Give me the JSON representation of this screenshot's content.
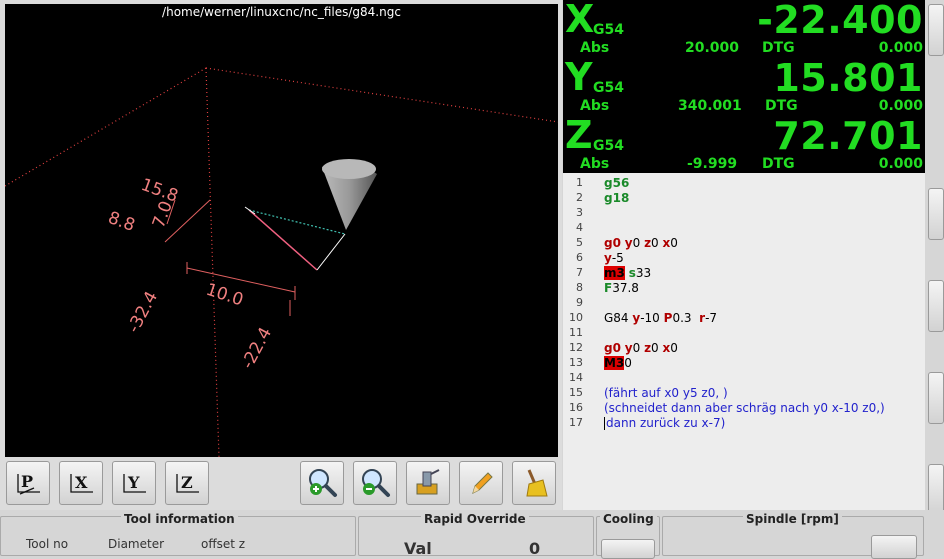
{
  "viewport": {
    "file_path": "/home/werner/linuxcnc/nc_files/g84.ngc",
    "dimension_labels": [
      "15.8",
      "8.8",
      "7.0",
      "10.0",
      "-32.4",
      "-22.4"
    ]
  },
  "toolbar": {
    "buttons": [
      {
        "name": "view-p-button",
        "label": "P"
      },
      {
        "name": "view-x-button",
        "label": "X"
      },
      {
        "name": "view-y-button",
        "label": "Y"
      },
      {
        "name": "view-z-button",
        "label": "Z"
      }
    ],
    "icon_buttons": [
      "zoom-in-icon",
      "zoom-out-icon",
      "rotate-view-icon",
      "pencil-icon",
      "broom-icon"
    ]
  },
  "dro": {
    "color": "#22dd22",
    "axes": [
      {
        "letter": "X",
        "coord": "G54",
        "value": "-22.400",
        "abs_label": "Abs",
        "abs": "20.000",
        "dtg_label": "DTG",
        "dtg": "0.000"
      },
      {
        "letter": "Y",
        "coord": "G54",
        "value": "15.801",
        "abs_label": "Abs",
        "abs": "340.001",
        "dtg_label": "DTG",
        "dtg": "0.000"
      },
      {
        "letter": "Z",
        "coord": "G54",
        "value": "72.701",
        "abs_label": "Abs",
        "abs": "-9.999",
        "dtg_label": "DTG",
        "dtg": "0.000"
      }
    ]
  },
  "editor": {
    "lines": [
      {
        "n": "1",
        "tokens": [
          {
            "t": "g56",
            "c": "g"
          }
        ]
      },
      {
        "n": "2",
        "tokens": [
          {
            "t": "g18",
            "c": "g"
          }
        ]
      },
      {
        "n": "3",
        "tokens": []
      },
      {
        "n": "4",
        "tokens": []
      },
      {
        "n": "5",
        "tokens": [
          {
            "t": "g0",
            "c": "ax"
          },
          {
            "t": " ",
            "c": ""
          },
          {
            "t": "y",
            "c": "ax"
          },
          {
            "t": "0 ",
            "c": ""
          },
          {
            "t": "z",
            "c": "ax"
          },
          {
            "t": "0 ",
            "c": ""
          },
          {
            "t": "x",
            "c": "ax"
          },
          {
            "t": "0",
            "c": ""
          }
        ]
      },
      {
        "n": "6",
        "tokens": [
          {
            "t": "y",
            "c": "ax"
          },
          {
            "t": "-5",
            "c": ""
          }
        ]
      },
      {
        "n": "7",
        "tokens": [
          {
            "t": "m3",
            "c": "m"
          },
          {
            "t": " ",
            "c": ""
          },
          {
            "t": "s",
            "c": "s"
          },
          {
            "t": "33",
            "c": ""
          }
        ]
      },
      {
        "n": "8",
        "tokens": [
          {
            "t": "F",
            "c": "f"
          },
          {
            "t": "37.8",
            "c": ""
          }
        ]
      },
      {
        "n": "9",
        "tokens": []
      },
      {
        "n": "10",
        "tokens": [
          {
            "t": "G84 ",
            "c": ""
          },
          {
            "t": "y",
            "c": "ax"
          },
          {
            "t": "-10 ",
            "c": ""
          },
          {
            "t": "P",
            "c": "p"
          },
          {
            "t": "0.3  ",
            "c": ""
          },
          {
            "t": "r",
            "c": "ax"
          },
          {
            "t": "-7",
            "c": ""
          }
        ]
      },
      {
        "n": "11",
        "tokens": []
      },
      {
        "n": "12",
        "tokens": [
          {
            "t": "g0",
            "c": "ax"
          },
          {
            "t": " ",
            "c": ""
          },
          {
            "t": "y",
            "c": "ax"
          },
          {
            "t": "0 ",
            "c": ""
          },
          {
            "t": "z",
            "c": "ax"
          },
          {
            "t": "0 ",
            "c": ""
          },
          {
            "t": "x",
            "c": "ax"
          },
          {
            "t": "0",
            "c": ""
          }
        ]
      },
      {
        "n": "13",
        "tokens": [
          {
            "t": "M3",
            "c": "m"
          },
          {
            "t": "0",
            "c": ""
          }
        ]
      },
      {
        "n": "14",
        "tokens": []
      },
      {
        "n": "15",
        "tokens": [
          {
            "t": "(fährt auf x0 y5 z0, )",
            "c": "c"
          }
        ]
      },
      {
        "n": "16",
        "tokens": [
          {
            "t": "(schneidet dann aber schräg nach y0 x-10 z0,)",
            "c": "c"
          }
        ]
      },
      {
        "n": "17",
        "tokens": [
          {
            "t": "|",
            "c": "caret"
          },
          {
            "t": "dann zurück zu x-7)",
            "c": "c"
          }
        ]
      }
    ]
  },
  "bottom": {
    "tool_info": {
      "title": "Tool information",
      "tool_no": "Tool no",
      "diameter": "Diameter",
      "offset_z": "offset z"
    },
    "rapid": {
      "title": "Rapid Override",
      "val_label": "Val",
      "val": "0"
    },
    "cooling": {
      "title": "Cooling"
    },
    "spindle": {
      "title": "Spindle [rpm]"
    }
  }
}
